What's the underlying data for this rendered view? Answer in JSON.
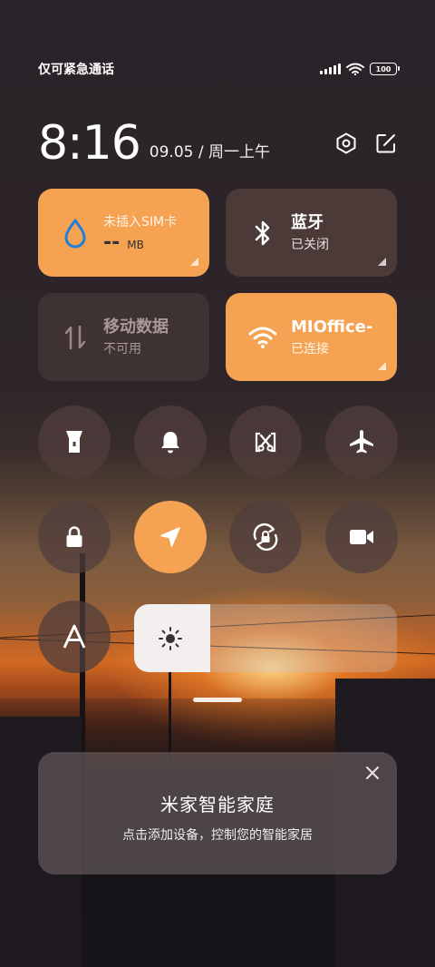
{
  "status_bar": {
    "carrier": "仅可紧急通话",
    "battery_level": "100"
  },
  "header": {
    "time": "8:16",
    "date": "09.05 / 周一上午"
  },
  "tiles": {
    "data_usage": {
      "title": "未插入SIM卡",
      "value": "--",
      "unit": "MB",
      "state": "on"
    },
    "bluetooth": {
      "title": "蓝牙",
      "status": "已关闭",
      "state": "off"
    },
    "mobile_data": {
      "title": "移动数据",
      "status": "不可用",
      "state": "disabled"
    },
    "wifi": {
      "title": "MIOffice-",
      "status": "已连接",
      "state": "on"
    }
  },
  "toggles": [
    {
      "name": "flashlight-icon",
      "state": "off"
    },
    {
      "name": "bell-icon",
      "state": "off"
    },
    {
      "name": "screenshot-icon",
      "state": "off"
    },
    {
      "name": "airplane-icon",
      "state": "off"
    },
    {
      "name": "lock-icon",
      "state": "off"
    },
    {
      "name": "location-icon",
      "state": "on"
    },
    {
      "name": "rotation-lock-icon",
      "state": "off"
    },
    {
      "name": "video-camera-icon",
      "state": "off"
    },
    {
      "name": "auto-brightness-icon",
      "state": "off"
    }
  ],
  "brightness": {
    "level": 0.29
  },
  "smart_home_card": {
    "title": "米家智能家庭",
    "subtitle": "点击添加设备，控制您的智能家居"
  },
  "colors": {
    "accent": "#f5a253",
    "tile_off": "#523e3c"
  }
}
